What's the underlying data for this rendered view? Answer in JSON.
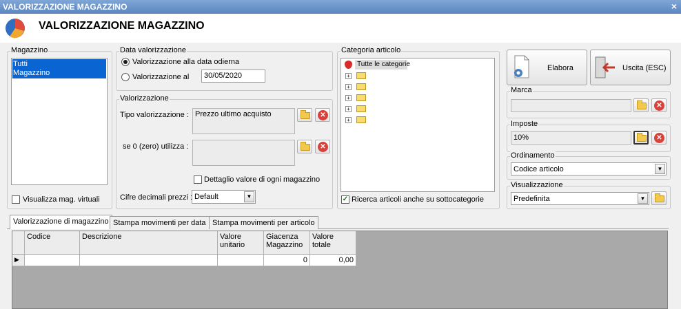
{
  "window": {
    "title": "VALORIZZAZIONE MAGAZZINO",
    "close": "×"
  },
  "header": {
    "title": "VALORIZZAZIONE MAGAZZINO"
  },
  "magazzino": {
    "legend": "Magazzino",
    "items": [
      "Tutti",
      "Magazzino"
    ],
    "virtual_label": "Visualizza mag. virtuali"
  },
  "data_val": {
    "legend": "Data valorizzazione",
    "opt_today": "Valorizzazione alla data odierna",
    "opt_at": "Valorizzazione al",
    "date_value": "30/05/2020"
  },
  "valorizzazione": {
    "legend": "Valorizzazione",
    "tipo_label": "Tipo valorizzazione :",
    "tipo_value": "Prezzo ultimo acquisto",
    "se0_label": "se 0 (zero) utilizza :",
    "se0_value": "",
    "dettaglio_label": "Dettaglio valore di ogni magazzino",
    "cifre_label": "Cifre decimali prezzi :",
    "cifre_value": "Default"
  },
  "categoria": {
    "legend": "Categoria articolo",
    "root": "Tutte le categorie",
    "ricerca_label": "Ricerca articoli anche su sottocategorie"
  },
  "buttons": {
    "elabora": "Elabora",
    "uscita": "Uscita (ESC)"
  },
  "marca": {
    "legend": "Marca",
    "value": ""
  },
  "imposte": {
    "legend": "Imposte",
    "value": "10%"
  },
  "ordinamento": {
    "legend": "Ordinamento",
    "value": "Codice articolo"
  },
  "visualizzazione": {
    "legend": "Visualizzazione",
    "value": "Predefinita"
  },
  "tabs": [
    {
      "label": "Valorizzazione di magazzino"
    },
    {
      "label": "Stampa movimenti per data"
    },
    {
      "label": "Stampa movimenti per articolo"
    }
  ],
  "table": {
    "headers": [
      "Codice",
      "Descrizione",
      "Valore unitario",
      "Giacenza Magazzino",
      "Valore totale"
    ],
    "row": [
      "",
      "",
      "",
      "0",
      "0,00"
    ]
  }
}
